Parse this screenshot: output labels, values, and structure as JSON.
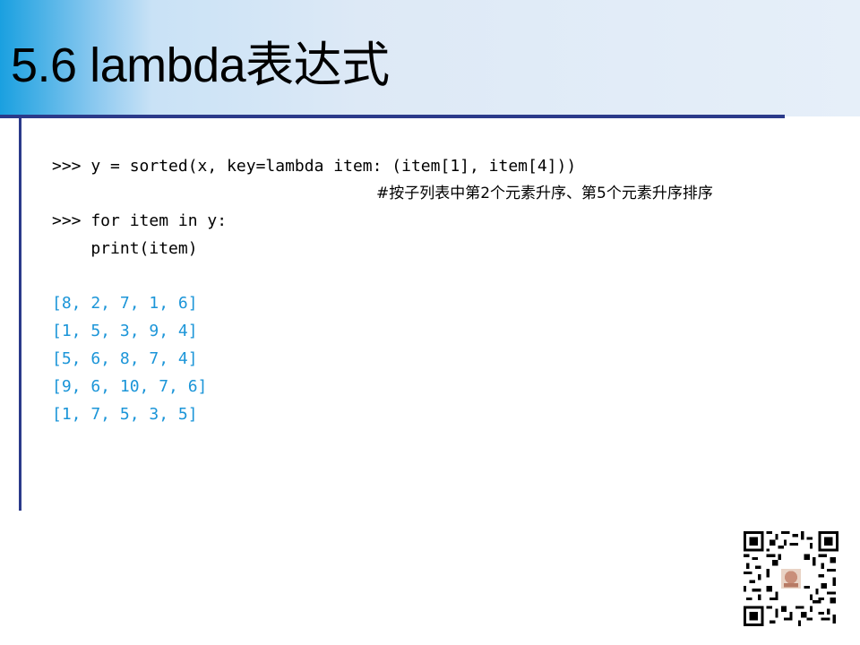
{
  "slide": {
    "title": "5.6 lambda表达式",
    "colors": {
      "header_gradient_start": "#1aa0e0",
      "header_gradient_end": "#e6eff9",
      "rule": "#2b3a8a",
      "output_text": "#1b95d8"
    }
  },
  "code": {
    "lines": [
      ">>> y = sorted(x, key=lambda item: (item[1], item[4]))",
      ">>> for item in y:",
      "    print(item)"
    ],
    "comment": "#按子列表中第2个元素升序、第5个元素升序排序"
  },
  "output": {
    "lines": [
      "[8, 2, 7, 1, 6]",
      "[1, 5, 3, 9, 4]",
      "[5, 6, 8, 7, 4]",
      "[9, 6, 10, 7, 6]",
      "[1, 7, 5, 3, 5]"
    ]
  },
  "qr": {
    "icon": "qr-code-icon"
  }
}
